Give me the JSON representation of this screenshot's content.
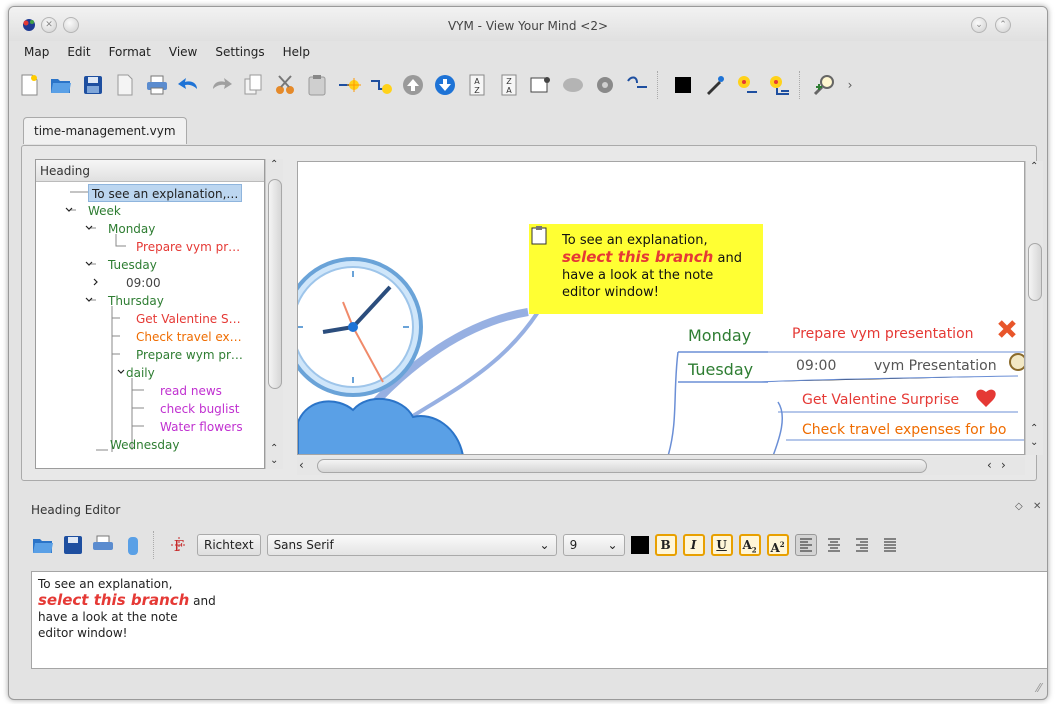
{
  "window": {
    "title": "VYM - View Your Mind <2>"
  },
  "menu": [
    "Map",
    "Edit",
    "Format",
    "View",
    "Settings",
    "Help"
  ],
  "toolbar": {
    "icons": [
      "new-map-icon",
      "open-icon",
      "save-icon",
      "export-icon",
      "print-icon",
      "undo-icon",
      "redo-icon",
      "copy-icon",
      "cut-icon",
      "paste-icon",
      "add-branch-icon",
      "add-branch-above-icon",
      "move-up-icon",
      "move-down-icon",
      "sort-az-icon",
      "sort-za-icon",
      "add-link-icon",
      "toggle-scroll-icon",
      "hide-icon",
      "link-to-icon",
      "color-black-icon",
      "pick-color-icon",
      "format-color-icon",
      "format-color-subtree-icon",
      "zoom-icon"
    ]
  },
  "tab": {
    "label": "time-management.vym"
  },
  "tree": {
    "header": "Heading",
    "rows": [
      {
        "label": "To see an explanation,…",
        "color": "#222222",
        "selected": true
      },
      {
        "label": "Week",
        "color": "#2e7d32"
      },
      {
        "label": "Monday",
        "color": "#2e7d32"
      },
      {
        "label": "Prepare vym pr…",
        "color": "#e53935"
      },
      {
        "label": "Tuesday",
        "color": "#2e7d32"
      },
      {
        "label": "09:00",
        "color": "#444444"
      },
      {
        "label": "Thursday",
        "color": "#2e7d32"
      },
      {
        "label": "Get Valentine S…",
        "color": "#e53935"
      },
      {
        "label": "Check travel ex…",
        "color": "#ef6c00"
      },
      {
        "label": "Prepare wym pr…",
        "color": "#2e7d32"
      },
      {
        "label": "daily",
        "color": "#2e7d32"
      },
      {
        "label": "read news",
        "color": "#c030d0"
      },
      {
        "label": "check buglist",
        "color": "#c030d0"
      },
      {
        "label": "Water flowers",
        "color": "#c030d0"
      },
      {
        "label": "Wednesday",
        "color": "#2e7d32"
      }
    ]
  },
  "map": {
    "note_line1": "To see an explanation,",
    "note_emph": "select this branch",
    "note_and": " and",
    "note_line3": "have a look at the note",
    "note_line4": "editor window!",
    "monday": "Monday",
    "tuesday": "Tuesday",
    "prepare": "Prepare vym presentation",
    "time": "09:00",
    "vym_presentation": "vym Presentation",
    "valentine": "Get Valentine Surprise",
    "travel": "Check travel expenses for bo",
    "colors": {
      "green": "#2e7d32",
      "red": "#e53935",
      "orange": "#ef6c00",
      "note_bg": "#ffff33",
      "link": "#6b8fd6"
    }
  },
  "editor": {
    "title": "Heading Editor",
    "richtext": "Richtext",
    "font": "Sans Serif",
    "size": "9",
    "format_buttons": [
      "B",
      "I",
      "U",
      "A",
      "A"
    ],
    "text_line1": "To see an explanation,",
    "text_emph": "select this branch",
    "text_and": " and",
    "text_line3": "have a look at the note",
    "text_line4": "editor window!"
  }
}
